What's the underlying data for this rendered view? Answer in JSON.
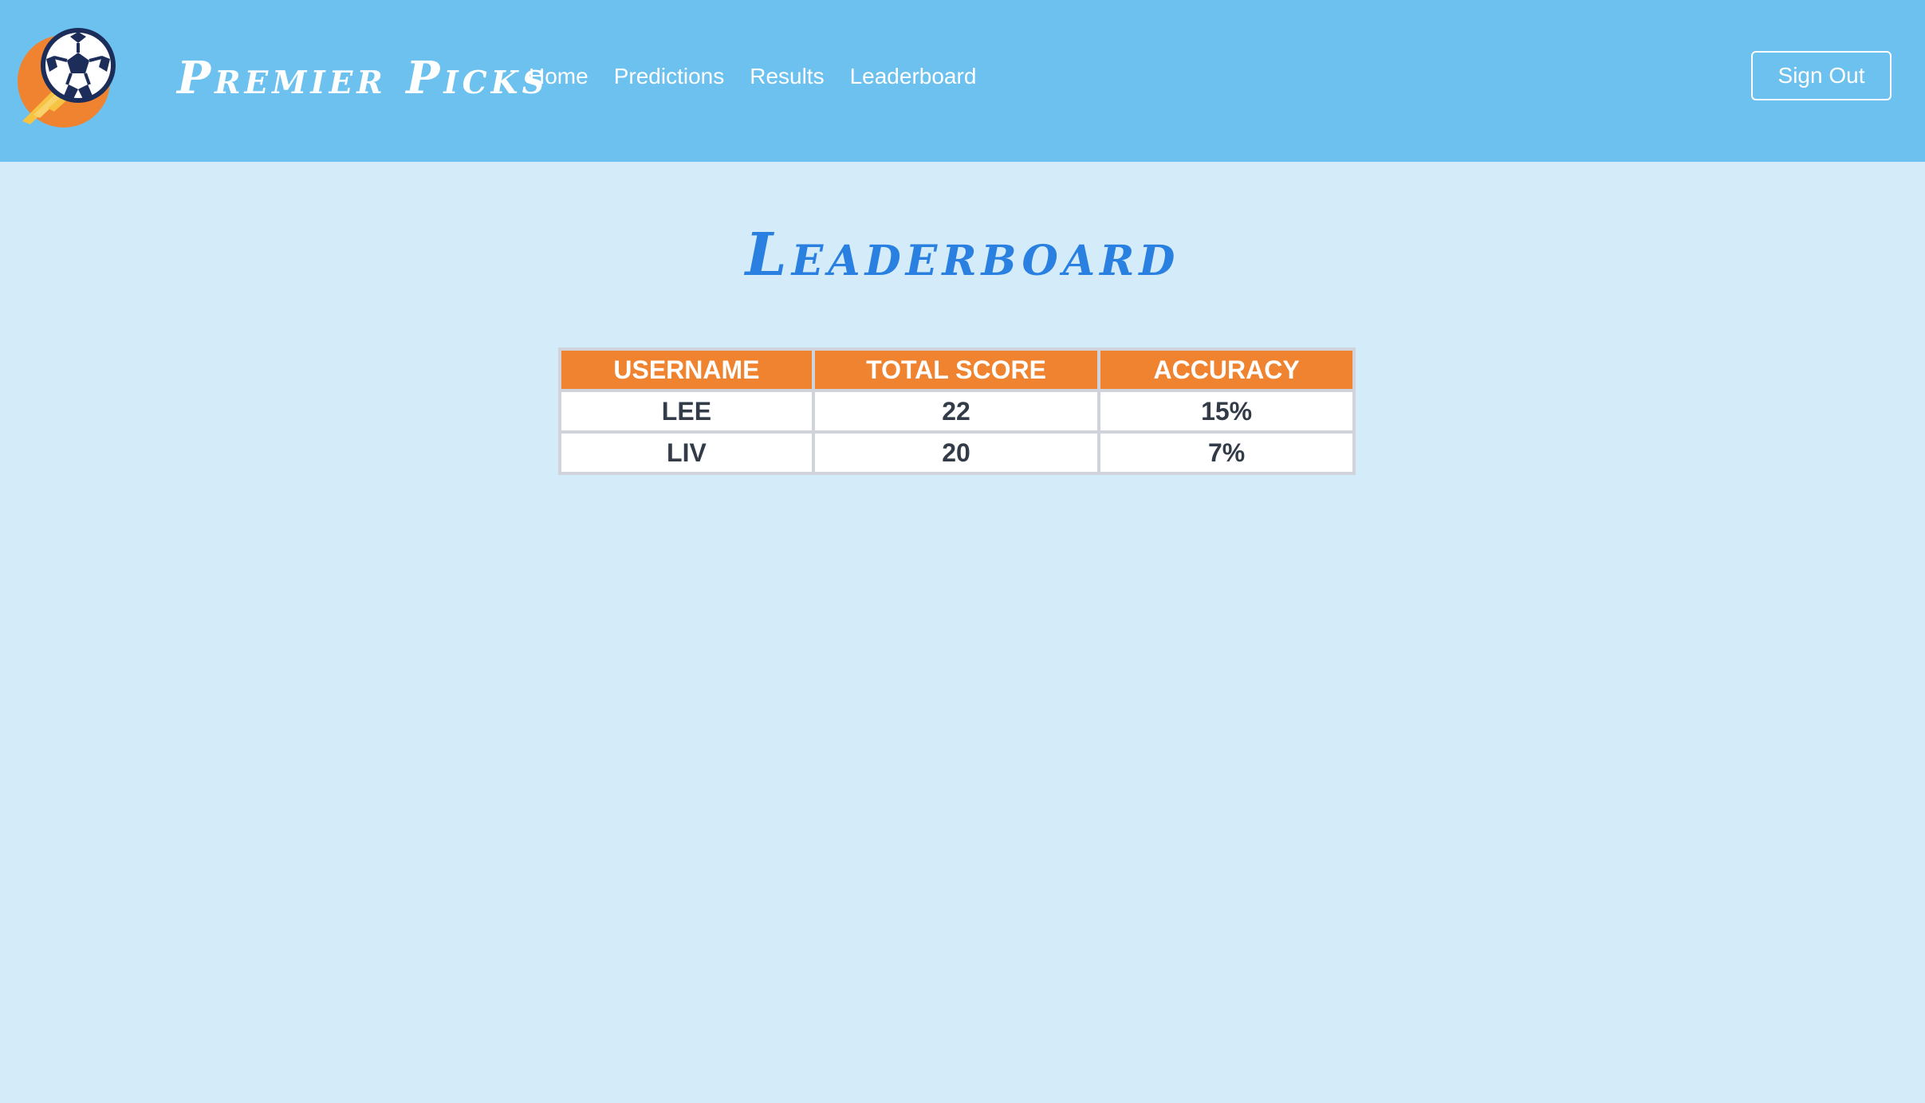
{
  "brand": {
    "name": "Premier Picks",
    "logo_icon": "soccer-ball-icon"
  },
  "nav": {
    "items": [
      {
        "label": "Home"
      },
      {
        "label": "Predictions"
      },
      {
        "label": "Results"
      },
      {
        "label": "Leaderboard"
      }
    ],
    "signout_label": "Sign Out"
  },
  "page": {
    "title": "Leaderboard"
  },
  "table": {
    "headers": [
      "USERNAME",
      "TOTAL SCORE",
      "ACCURACY"
    ],
    "rows": [
      [
        "LEE",
        "22",
        "15%"
      ],
      [
        "LIV",
        "20",
        "7%"
      ]
    ]
  },
  "colors": {
    "navbar": "#6cc1ef",
    "background": "#d4ebf9",
    "title": "#2a80e0",
    "table_header": "#f0832f",
    "ball_dark": "#1c2d5a",
    "logo_orange": "#f0832f",
    "logo_yellow": "#f7c343"
  }
}
